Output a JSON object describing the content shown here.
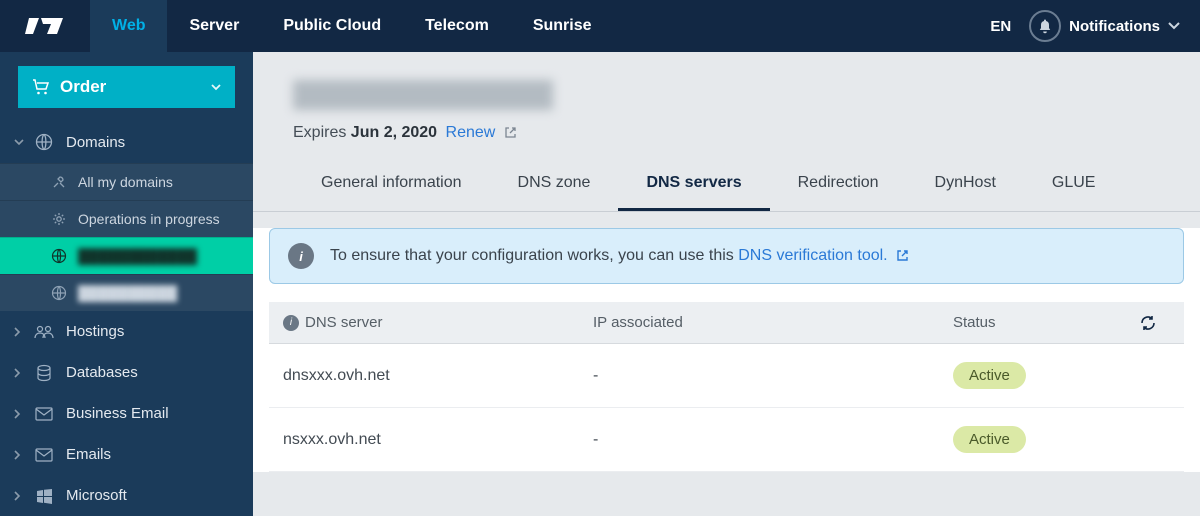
{
  "topnav": {
    "items": [
      {
        "label": "Web",
        "active": true
      },
      {
        "label": "Server",
        "active": false
      },
      {
        "label": "Public Cloud",
        "active": false
      },
      {
        "label": "Telecom",
        "active": false
      },
      {
        "label": "Sunrise",
        "active": false
      }
    ],
    "lang": "EN",
    "notifications_label": "Notifications"
  },
  "sidebar": {
    "order_label": "Order",
    "sections": {
      "domains": {
        "label": "Domains",
        "expanded": true
      },
      "hostings": {
        "label": "Hostings"
      },
      "databases": {
        "label": "Databases"
      },
      "business_email": {
        "label": "Business Email"
      },
      "emails": {
        "label": "Emails"
      },
      "microsoft": {
        "label": "Microsoft"
      }
    },
    "domains_sub": {
      "all_my_domains": "All my domains",
      "operations": "Operations in progress",
      "domain_a": "████████████",
      "domain_b": "██████████"
    }
  },
  "page": {
    "expires_prefix": "Expires ",
    "expires_date": "Jun 2, 2020",
    "renew_label": "Renew"
  },
  "tabs": [
    {
      "key": "general",
      "label": "General information",
      "active": false
    },
    {
      "key": "dnszone",
      "label": "DNS zone",
      "active": false
    },
    {
      "key": "dnsservers",
      "label": "DNS servers",
      "active": true
    },
    {
      "key": "redirection",
      "label": "Redirection",
      "active": false
    },
    {
      "key": "dynhost",
      "label": "DynHost",
      "active": false
    },
    {
      "key": "glue",
      "label": "GLUE",
      "active": false
    }
  ],
  "info_banner": {
    "text_before": "To ensure that your configuration works, you can use this ",
    "link_text": "DNS verification tool."
  },
  "table": {
    "headers": {
      "dns_server": "DNS server",
      "ip_associated": "IP associated",
      "status": "Status"
    },
    "rows": [
      {
        "server": "dnsxxx.ovh.net",
        "ip": "-",
        "status": "Active"
      },
      {
        "server": "nsxxx.ovh.net",
        "ip": "-",
        "status": "Active"
      }
    ]
  }
}
